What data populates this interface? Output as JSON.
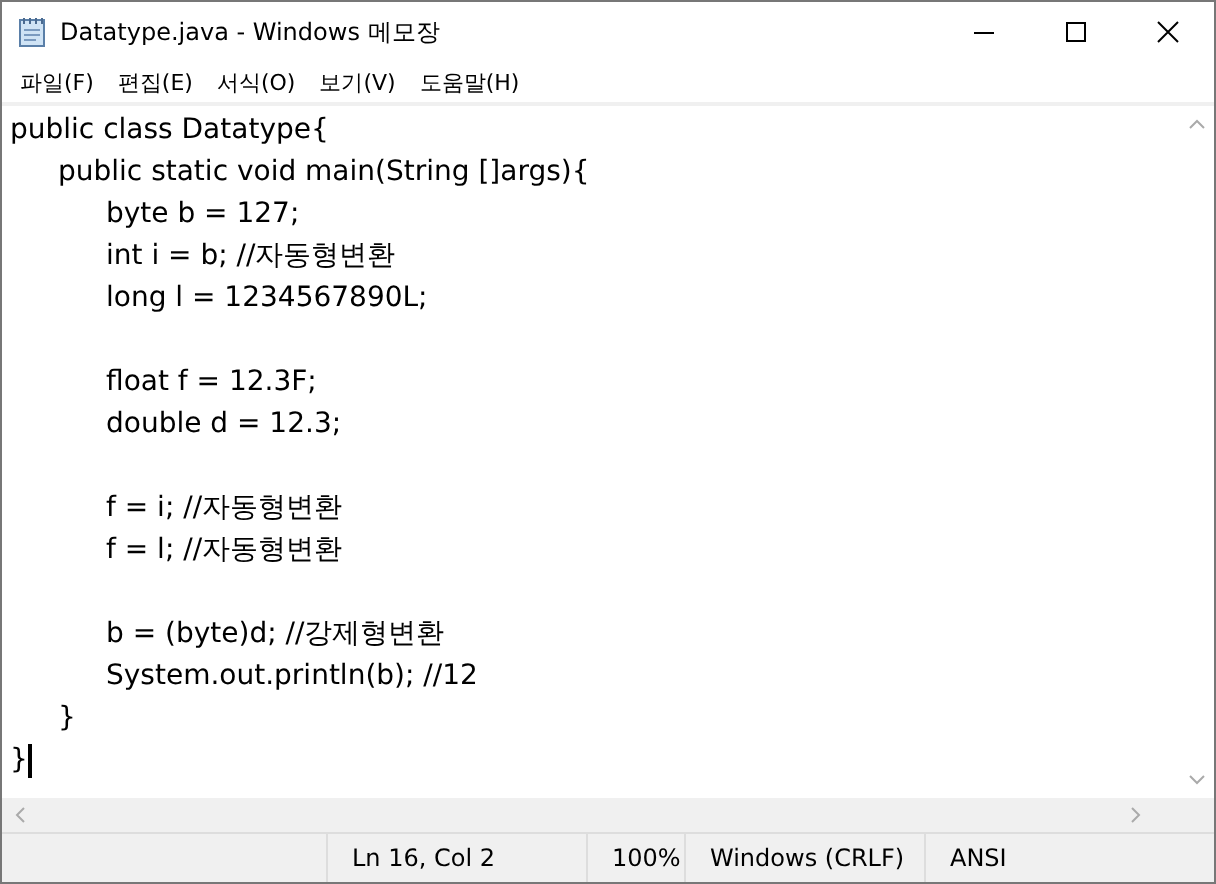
{
  "window": {
    "title": "Datatype.java - Windows 메모장"
  },
  "menu": [
    "파일(F)",
    "편집(E)",
    "서식(O)",
    "보기(V)",
    "도움말(H)"
  ],
  "editor": {
    "lines": [
      {
        "kind": "code",
        "text": "public class Datatype{"
      },
      {
        "kind": "code",
        "text": "\tpublic static void main(String []args){"
      },
      {
        "kind": "code",
        "text": "\t\tbyte b = 127;"
      },
      {
        "kind": "code",
        "text": "\t\tint i = b; //자동형변환"
      },
      {
        "kind": "code",
        "text": "\t\tlong l = 1234567890L;"
      },
      {
        "kind": "blank"
      },
      {
        "kind": "code",
        "text": "\t\tfloat f = 12.3F;"
      },
      {
        "kind": "code",
        "text": "\t\tdouble d = 12.3;"
      },
      {
        "kind": "blank"
      },
      {
        "kind": "code",
        "text": "\t\tf = i; //자동형변환"
      },
      {
        "kind": "code",
        "text": "\t\tf = l; //자동형변환"
      },
      {
        "kind": "blank"
      },
      {
        "kind": "code",
        "text": "\t\tb = (byte)d; //강제형변환"
      },
      {
        "kind": "code",
        "text": "\t\tSystem.out.println(b); //12"
      },
      {
        "kind": "code",
        "text": "\t}"
      },
      {
        "kind": "code",
        "text": "}",
        "caret": true
      }
    ]
  },
  "status_bar": {
    "position": "Ln 16, Col 2",
    "zoom": "100%",
    "line_ending": "Windows (CRLF)",
    "encoding": "ANSI"
  }
}
